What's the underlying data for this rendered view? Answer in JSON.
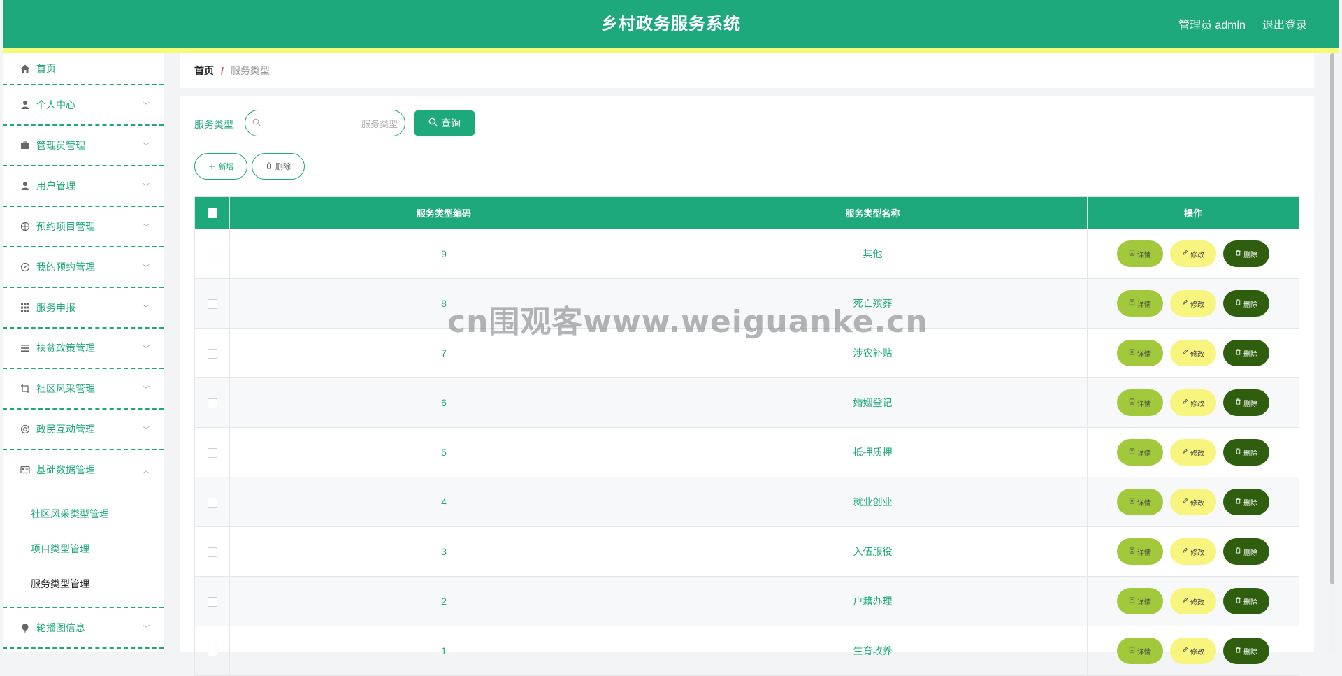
{
  "header": {
    "title": "乡村政务服务系统",
    "user": "管理员 admin",
    "logout": "退出登录"
  },
  "sidebar": {
    "home": "首页",
    "items": [
      {
        "label": "个人中心",
        "icon": "user-icon"
      },
      {
        "label": "管理员管理",
        "icon": "briefcase-icon"
      },
      {
        "label": "用户管理",
        "icon": "user-icon"
      },
      {
        "label": "预约项目管理",
        "icon": "aperture-icon"
      },
      {
        "label": "我的预约管理",
        "icon": "compass-icon"
      },
      {
        "label": "服务申报",
        "icon": "grid-icon"
      },
      {
        "label": "扶贫政策管理",
        "icon": "list-icon"
      },
      {
        "label": "社区风采管理",
        "icon": "crop-icon"
      },
      {
        "label": "政民互动管理",
        "icon": "lifebuoy-icon"
      },
      {
        "label": "基础数据管理",
        "icon": "id-card-icon"
      }
    ],
    "submenu": [
      "社区风采类型管理",
      "项目类型管理",
      "服务类型管理"
    ],
    "last": {
      "label": "轮播图信息",
      "icon": "balloon-icon"
    }
  },
  "breadcrumb": {
    "home": "首页",
    "separator": "/",
    "current": "服务类型"
  },
  "search": {
    "label": "服务类型",
    "placeholder": "服务类型",
    "value": "",
    "button": "查询"
  },
  "actions": {
    "add": "新增",
    "delete": "删除"
  },
  "table": {
    "headers": [
      "服务类型编码",
      "服务类型名称",
      "操作"
    ],
    "rows": [
      {
        "code": "9",
        "name": "其他"
      },
      {
        "code": "8",
        "name": "死亡殡葬"
      },
      {
        "code": "7",
        "name": "涉农补贴"
      },
      {
        "code": "6",
        "name": "婚姻登记"
      },
      {
        "code": "5",
        "name": "抵押质押"
      },
      {
        "code": "4",
        "name": "就业创业"
      },
      {
        "code": "3",
        "name": "入伍服役"
      },
      {
        "code": "2",
        "name": "户籍办理"
      },
      {
        "code": "1",
        "name": "生育收养"
      }
    ],
    "row_buttons": {
      "detail": "详情",
      "edit": "修改",
      "delete": "删除"
    }
  },
  "watermark": "cn围观客www.weiguanke.cn",
  "colors": {
    "primary": "#1ea97c",
    "accent_bar": "#f4fb74",
    "detail_btn": "#a1c93b",
    "edit_btn": "#f7f57e",
    "delete_btn": "#2f5f0e"
  }
}
